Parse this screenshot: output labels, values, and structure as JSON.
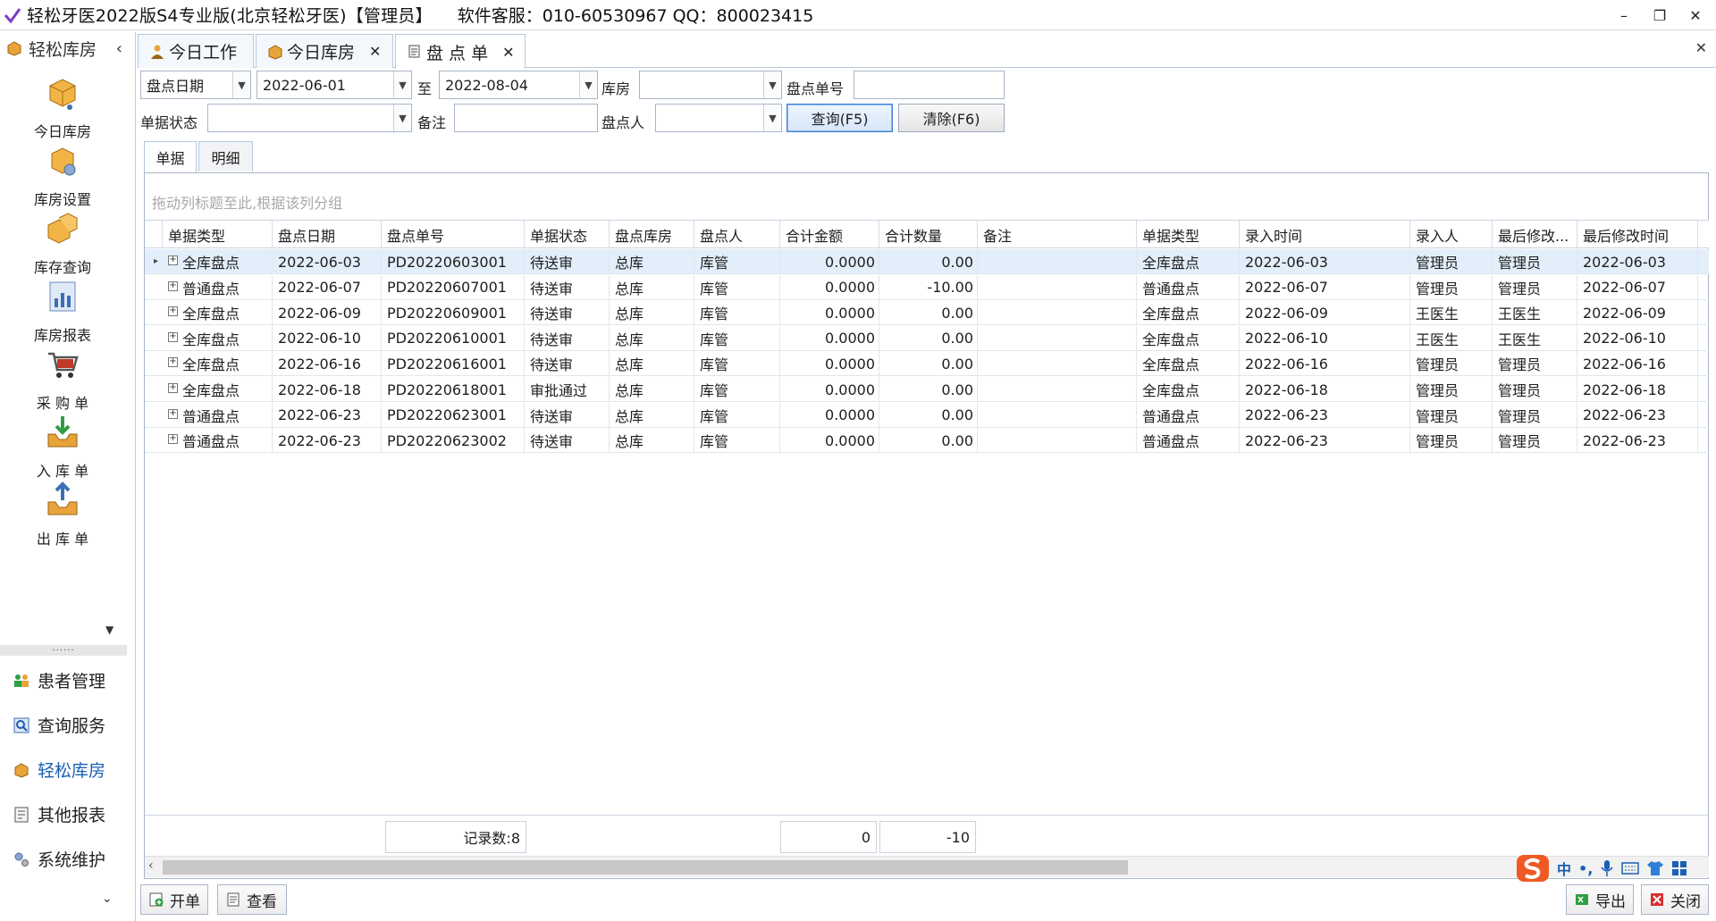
{
  "window": {
    "title": "轻松牙医2022版S4专业版(北京轻松牙医)【管理员】",
    "support": "软件客服：010-60530967 QQ：800023415"
  },
  "sidebar": {
    "header": "轻松库房",
    "items": [
      {
        "label": "今日库房",
        "icon": "box-cart-icon"
      },
      {
        "label": "库房设置",
        "icon": "box-gear-icon"
      },
      {
        "label": "库存查询",
        "icon": "boxes-icon"
      },
      {
        "label": "库房报表",
        "icon": "chart-report-icon"
      },
      {
        "label": "采 购 单",
        "icon": "shopping-cart-icon"
      },
      {
        "label": "入 库 单",
        "icon": "inbox-down-icon"
      },
      {
        "label": "出 库 单",
        "icon": "inbox-up-icon"
      }
    ],
    "nav": [
      {
        "label": "患者管理",
        "icon": "patients-icon",
        "active": false
      },
      {
        "label": "查询服务",
        "icon": "search-icon",
        "active": false
      },
      {
        "label": "轻松库房",
        "icon": "warehouse-icon",
        "active": true
      },
      {
        "label": "其他报表",
        "icon": "report-icon",
        "active": false
      },
      {
        "label": "系统维护",
        "icon": "gears-icon",
        "active": false
      }
    ]
  },
  "tabs": [
    {
      "label": "今日工作",
      "closable": false
    },
    {
      "label": "今日库房",
      "closable": true
    },
    {
      "label": "盘 点 单",
      "closable": true,
      "active": true
    }
  ],
  "filters": {
    "date_field": "盘点日期",
    "date_from": "2022-06-01",
    "to_label": "至",
    "date_to": "2022-08-04",
    "warehouse_label": "库房",
    "warehouse_value": "",
    "order_no_label": "盘点单号",
    "order_no_value": "",
    "status_label": "单据状态",
    "status_value": "",
    "remark_label": "备注",
    "remark_value": "",
    "counter_label": "盘点人",
    "counter_value": "",
    "query_button": "查询(F5)",
    "clear_button": "清除(F6)"
  },
  "subtabs": [
    "单据",
    "明细"
  ],
  "grid": {
    "group_hint": "拖动列标题至此,根据该列分组",
    "columns": [
      "单据类型",
      "盘点日期",
      "盘点单号",
      "单据状态",
      "盘点库房",
      "盘点人",
      "合计金额",
      "合计数量",
      "备注",
      "单据类型",
      "录入时间",
      "录入人",
      "最后修改...",
      "最后修改时间"
    ],
    "rows": [
      [
        "全库盘点",
        "2022-06-03",
        "PD20220603001",
        "待送审",
        "总库",
        "库管",
        "0.0000",
        "0.00",
        "",
        "全库盘点",
        "2022-06-03",
        "管理员",
        "管理员",
        "2022-06-03"
      ],
      [
        "普通盘点",
        "2022-06-07",
        "PD20220607001",
        "待送审",
        "总库",
        "库管",
        "0.0000",
        "-10.00",
        "",
        "普通盘点",
        "2022-06-07",
        "管理员",
        "管理员",
        "2022-06-07"
      ],
      [
        "全库盘点",
        "2022-06-09",
        "PD20220609001",
        "待送审",
        "总库",
        "库管",
        "0.0000",
        "0.00",
        "",
        "全库盘点",
        "2022-06-09",
        "王医生",
        "王医生",
        "2022-06-09"
      ],
      [
        "全库盘点",
        "2022-06-10",
        "PD20220610001",
        "待送审",
        "总库",
        "库管",
        "0.0000",
        "0.00",
        "",
        "全库盘点",
        "2022-06-10",
        "王医生",
        "王医生",
        "2022-06-10"
      ],
      [
        "全库盘点",
        "2022-06-16",
        "PD20220616001",
        "待送审",
        "总库",
        "库管",
        "0.0000",
        "0.00",
        "",
        "全库盘点",
        "2022-06-16",
        "管理员",
        "管理员",
        "2022-06-16"
      ],
      [
        "全库盘点",
        "2022-06-18",
        "PD20220618001",
        "审批通过",
        "总库",
        "库管",
        "0.0000",
        "0.00",
        "",
        "全库盘点",
        "2022-06-18",
        "管理员",
        "管理员",
        "2022-06-18"
      ],
      [
        "普通盘点",
        "2022-06-23",
        "PD20220623001",
        "待送审",
        "总库",
        "库管",
        "0.0000",
        "0.00",
        "",
        "普通盘点",
        "2022-06-23",
        "管理员",
        "管理员",
        "2022-06-23"
      ],
      [
        "普通盘点",
        "2022-06-23",
        "PD20220623002",
        "待送审",
        "总库",
        "库管",
        "0.0000",
        "0.00",
        "",
        "普通盘点",
        "2022-06-23",
        "管理员",
        "管理员",
        "2022-06-23"
      ]
    ],
    "footer": {
      "record_count": "记录数:8",
      "sum_amount": "0",
      "sum_qty": "-10"
    }
  },
  "bottom": {
    "new": "开单",
    "view": "查看",
    "export": "导出",
    "close": "关闭"
  },
  "ime": {
    "mode": "中"
  },
  "colors": {
    "accent": "#1a5fb4",
    "selected_row": "#e3eefb",
    "border": "#a8b6c8"
  }
}
